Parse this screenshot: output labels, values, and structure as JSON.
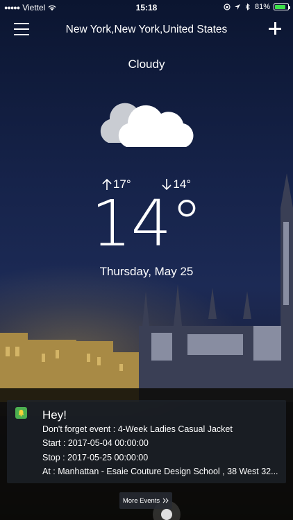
{
  "status_bar": {
    "carrier": "Viettel",
    "time": "15:18",
    "battery": "81%",
    "battery_level": 0.81
  },
  "header": {
    "location": "New York,New York,United States",
    "menu_icon": "hamburger-icon",
    "add_icon": "plus-icon"
  },
  "weather": {
    "condition": "Cloudy",
    "icon": "cloud-icon",
    "high": "17°",
    "low": "14°",
    "current_temp": "14°",
    "date": "Thursday, May 25"
  },
  "event": {
    "icon": "bell-icon",
    "title": "Hey!",
    "line1": "Don't forget event : 4-Week Ladies Casual Jacket",
    "line2": "Start : 2017-05-04 00:00:00",
    "line3": "Stop : 2017-05-25 00:00:00",
    "line4": "At : Manhattan - Esaie Couture Design School , 38 West 32..."
  },
  "more_events": {
    "label": "More Events"
  },
  "colors": {
    "battery": "#3de04a",
    "event_icon": "#4caf50"
  }
}
